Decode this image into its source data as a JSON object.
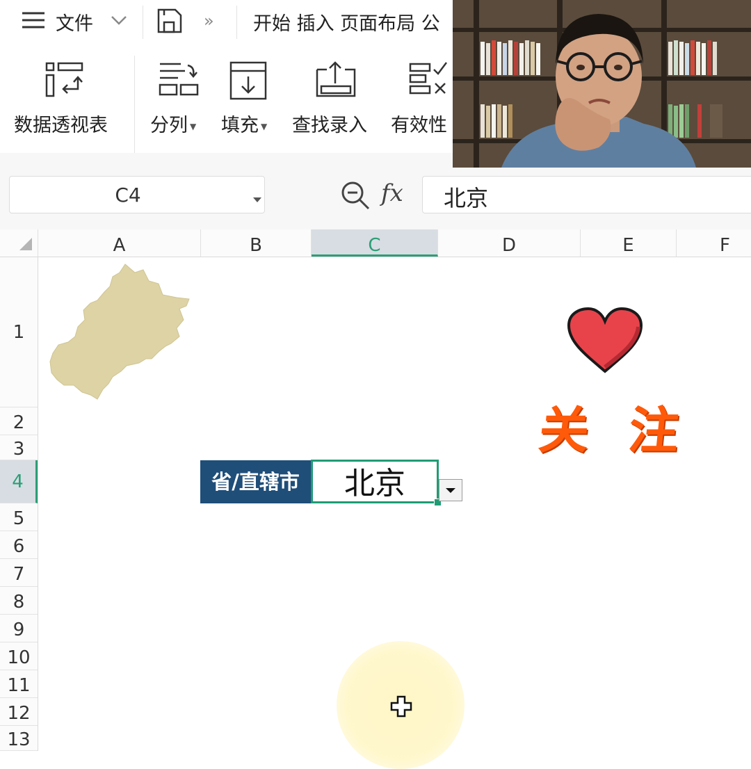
{
  "menubar": {
    "file_label": "文件",
    "tabs_label": "开始 插入 页面布局 公"
  },
  "ribbon": {
    "items": [
      {
        "label": "数据透视表",
        "icon": "pivot-table-icon"
      },
      {
        "label": "分列",
        "icon": "split-columns-icon",
        "has_dropdown": true
      },
      {
        "label": "填充",
        "icon": "fill-icon",
        "has_dropdown": true
      },
      {
        "label": "查找录入",
        "icon": "lookup-entry-icon"
      },
      {
        "label": "有效性",
        "icon": "validation-icon"
      }
    ]
  },
  "formula_bar": {
    "name_box": "C4",
    "fx_label": "fx",
    "content": "北京"
  },
  "grid": {
    "columns": [
      "A",
      "B",
      "C",
      "D",
      "E",
      "F"
    ],
    "active_column": "C",
    "rows": [
      "1",
      "2",
      "3",
      "4",
      "5",
      "6",
      "7",
      "8",
      "9",
      "10",
      "11",
      "12",
      "13"
    ],
    "active_row": "4",
    "label_cell": "省/直辖市",
    "value_cell": "北京"
  },
  "overlay": {
    "follow_text": "关 注"
  },
  "colors": {
    "accent_green": "#1f9c74",
    "header_blue": "#1f4e79",
    "map_fill": "#ddd3a4",
    "heart_red": "#e8434b",
    "follow_orange": "#ff5a0a"
  }
}
